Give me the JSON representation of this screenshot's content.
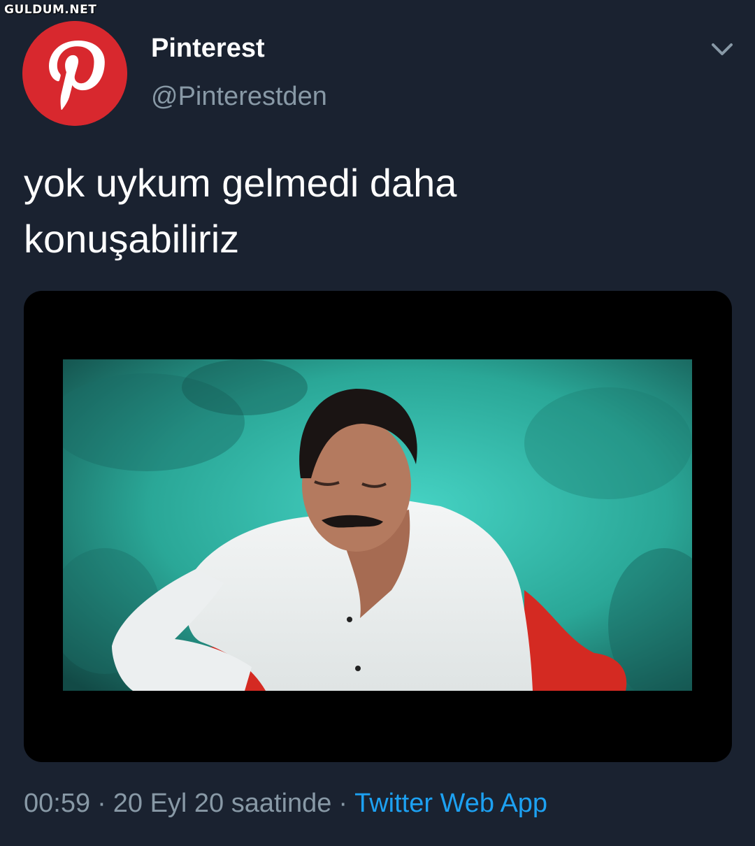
{
  "watermark": "GULDUM.NET",
  "account": {
    "display_name": "Pinterest",
    "handle": "@Pinterestden",
    "avatar_icon": "pinterest-logo-icon",
    "avatar_color": "#d8282e"
  },
  "menu_icon": "chevron-down-icon",
  "tweet": {
    "text_line1": "yok uykum gelmedi daha",
    "text_line2": "konuşabiliriz"
  },
  "media": {
    "type": "video-still",
    "background_color": "#2fb3a6"
  },
  "meta": {
    "time": "00:59",
    "date": "20 Eyl 20 saatinde",
    "separator": "·",
    "source": "Twitter Web App"
  },
  "colors": {
    "background": "#1a2230",
    "text_primary": "#ffffff",
    "text_secondary": "#8899a6",
    "link": "#1da1f2"
  }
}
